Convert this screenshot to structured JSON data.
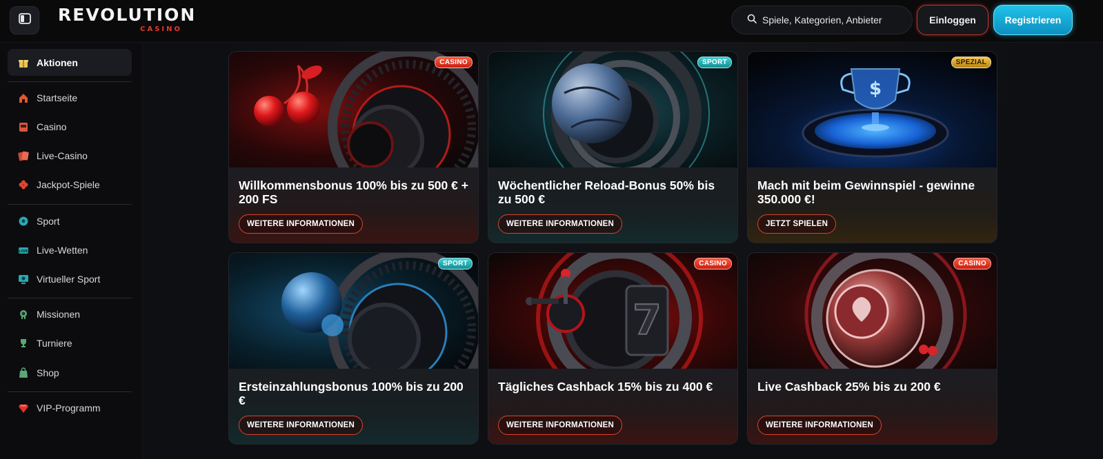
{
  "header": {
    "logo_main": "REVOLUTION",
    "logo_sub": "CASINO",
    "search_placeholder": "Spiele, Kategorien, Anbieter",
    "login_label": "Einloggen",
    "register_label": "Registrieren",
    "menu_icon": "sidebar-toggle-icon",
    "search_icon": "search-icon"
  },
  "sidebar": {
    "items": [
      {
        "label": "Aktionen",
        "icon": "gift-icon",
        "active": true
      },
      {
        "label": "Startseite",
        "icon": "home-icon"
      },
      {
        "label": "Casino",
        "icon": "slot-machine-icon"
      },
      {
        "label": "Live-Casino",
        "icon": "cards-icon"
      },
      {
        "label": "Jackpot-Spiele",
        "icon": "clover-icon"
      },
      {
        "label": "Sport",
        "icon": "soccer-ball-icon"
      },
      {
        "label": "Live-Wetten",
        "icon": "live-icon"
      },
      {
        "label": "Virtueller Sport",
        "icon": "monitor-icon"
      },
      {
        "label": "Missionen",
        "icon": "medal-icon"
      },
      {
        "label": "Turniere",
        "icon": "trophy-icon"
      },
      {
        "label": "Shop",
        "icon": "shop-icon"
      },
      {
        "label": "VIP-Programm",
        "icon": "diamond-icon"
      }
    ]
  },
  "promos": [
    {
      "title": "Willkommensbonus 100% bis zu 500 € + 200 FS",
      "badge": "CASINO",
      "cta": "WEITERE INFORMATIONEN"
    },
    {
      "title": "Wöchentlicher Reload-Bonus 50% bis zu 500 €",
      "badge": "SPORT",
      "cta": "WEITERE INFORMATIONEN"
    },
    {
      "title": "Mach mit beim Gewinnspiel - gewinne 350.000 €!",
      "badge": "SPEZIAL",
      "cta": "JETZT SPIELEN"
    },
    {
      "title": "Ersteinzahlungsbonus 100% bis zu 200 €",
      "badge": "SPORT",
      "cta": "WEITERE INFORMATIONEN"
    },
    {
      "title": "Tägliches Cashback 15% bis zu 400 €",
      "badge": "CASINO",
      "cta": "WEITERE INFORMATIONEN"
    },
    {
      "title": "Live Cashback 25% bis zu 200 €",
      "badge": "CASINO",
      "cta": "WEITERE INFORMATIONEN"
    }
  ],
  "colors": {
    "accent_red": "#d9452f",
    "accent_cyan": "#1fc3e8",
    "badge_casino": "#e0341f",
    "badge_sport": "#26b6bd",
    "badge_spezial": "#d9a52a"
  }
}
